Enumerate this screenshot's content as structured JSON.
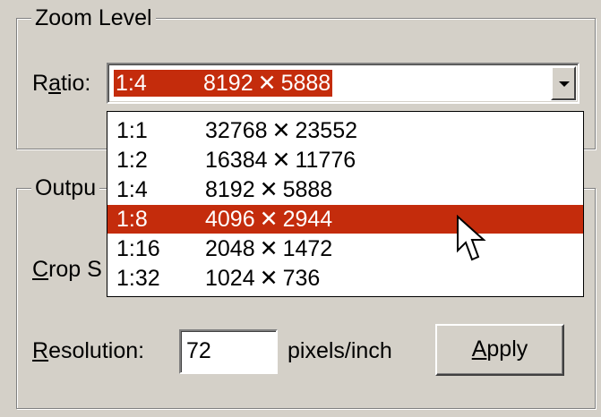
{
  "zoom_group": {
    "title": "Zoom Level",
    "ratio_label_pre": "R",
    "ratio_label_u": "a",
    "ratio_label_post": "tio:",
    "selected_ratio": "1:4",
    "selected_dims": "8192 ✕ 5888"
  },
  "ratio_options": [
    {
      "ratio": "1:1",
      "dims": "32768 ✕ 23552",
      "selected": false
    },
    {
      "ratio": "1:2",
      "dims": "16384 ✕ 11776",
      "selected": false
    },
    {
      "ratio": "1:4",
      "dims": "8192 ✕ 5888",
      "selected": false
    },
    {
      "ratio": "1:8",
      "dims": "4096 ✕ 2944",
      "selected": true
    },
    {
      "ratio": "1:16",
      "dims": "2048 ✕ 1472",
      "selected": false
    },
    {
      "ratio": "1:32",
      "dims": "1024 ✕ 736",
      "selected": false
    }
  ],
  "output_group": {
    "title_visible": "Outpu",
    "crop_label_u": "C",
    "crop_label_rest": "rop S",
    "resolution_label_u": "R",
    "resolution_label_rest": "esolution:",
    "resolution_value": "72",
    "unit_label": "pixels/inch",
    "apply_label_u": "A",
    "apply_label_rest": "pply"
  },
  "colors": {
    "selection": "#c42c0c",
    "face": "#d4d0c8"
  },
  "icons": {
    "dropdown_button": "chevron-down-icon",
    "cursor": "mouse-pointer-icon"
  }
}
